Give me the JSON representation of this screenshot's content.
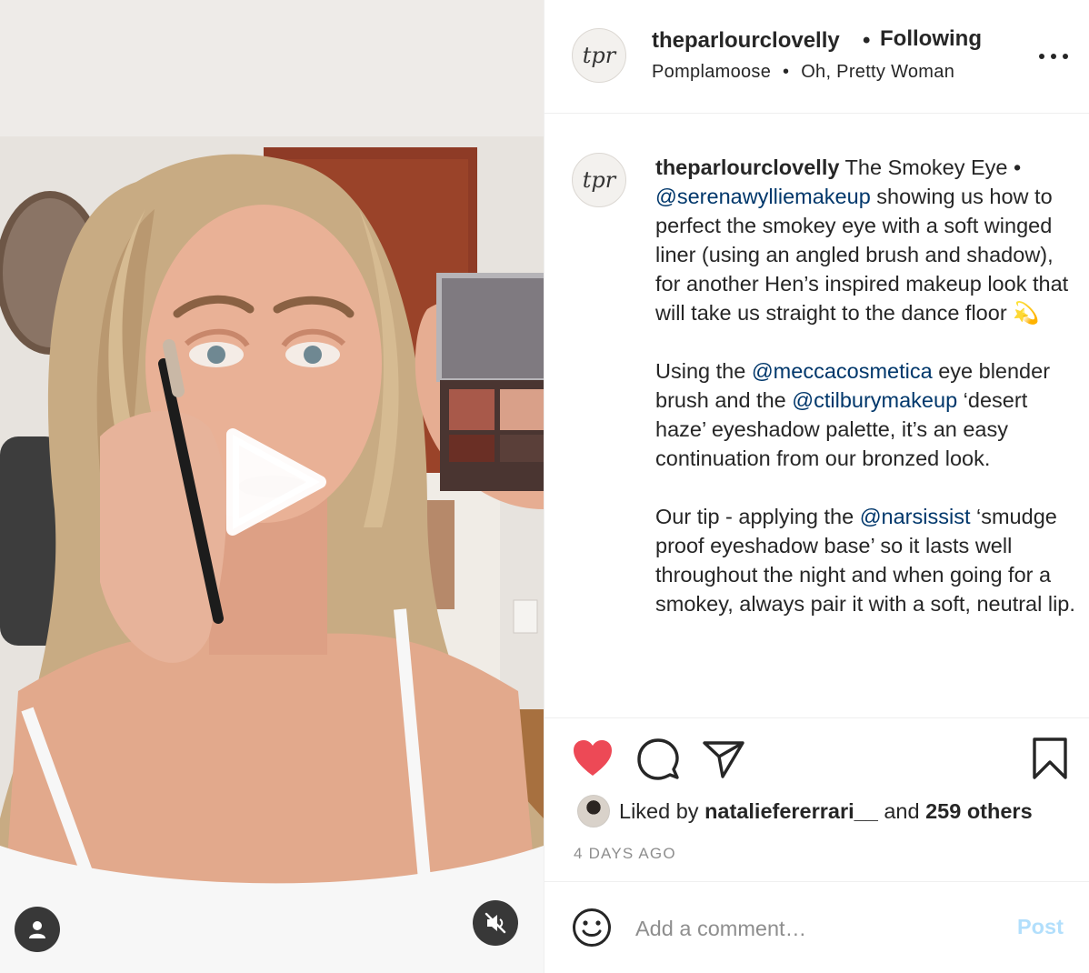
{
  "colors": {
    "text": "#262626",
    "secondary": "#8e8e8e",
    "link": "#00376b",
    "like_red": "#ed4956",
    "post_disabled": "#b2dffc",
    "border": "#efefef"
  },
  "header": {
    "avatar_text": "tpr",
    "username": "theparlourclovelly",
    "separator": "•",
    "follow_status": "Following",
    "music_artist": "Pomplamoose",
    "music_separator": "•",
    "music_track": "Oh, Pretty Woman",
    "more_icon": "more-horizontal-icon"
  },
  "media": {
    "type": "video",
    "play_icon": "play-icon",
    "user_tag_icon": "user-icon",
    "mute_icon": "muted-speaker-icon"
  },
  "caption": {
    "avatar_text": "tpr",
    "username": "theparlourclovelly",
    "p1_text1": " The Smokey Eye • ",
    "p1_mention1": "@serenawylliemakeup",
    "p1_text2": " showing us how to perfect the smokey eye with a soft winged liner (using an angled brush and shadow), for another Hen’s inspired makeup look that will take us straight to the dance floor ",
    "p1_emoji": "💫",
    "p2_text1": "Using the ",
    "p2_mention1": "@meccacosmetica",
    "p2_text2": " eye blender brush and the ",
    "p2_mention2": "@ctilburymakeup",
    "p2_text3": " ‘desert haze’ eyeshadow palette, it’s an easy continuation from our bronzed look.",
    "p3_text1": "Our tip - applying the ",
    "p3_mention1": "@narsissist",
    "p3_text2": " ‘smudge proof eyeshadow base’ so it lasts well throughout the night and when going for a smokey, always pair it with a soft, neutral lip."
  },
  "actions": {
    "like_icon": "heart-filled-icon",
    "comment_icon": "comment-icon",
    "share_icon": "paper-plane-icon",
    "save_icon": "bookmark-icon",
    "liked_by_prefix": "Liked by ",
    "liked_by_user": "nataliefererrari__",
    "liked_by_and": " and ",
    "liked_by_others": "259 others",
    "timestamp": "4 DAYS AGO"
  },
  "comment": {
    "emoji_icon": "smiley-icon",
    "placeholder": "Add a comment…",
    "post_label": "Post"
  }
}
